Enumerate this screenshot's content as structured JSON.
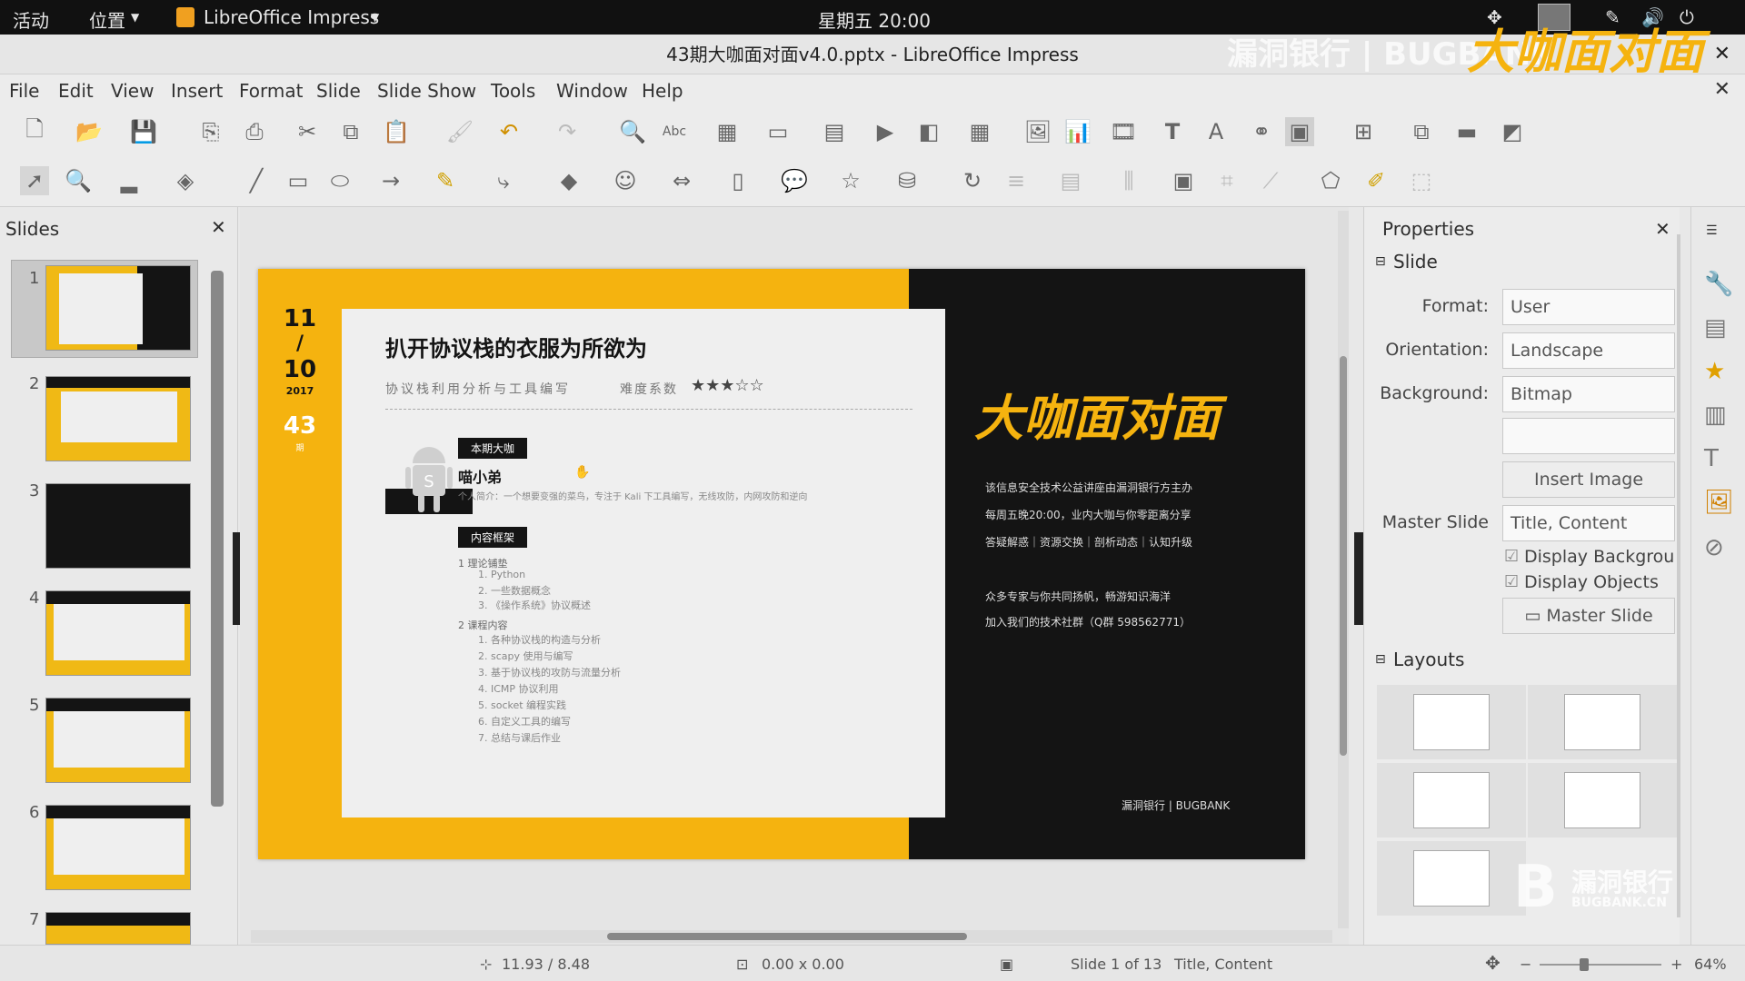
{
  "topbar": {
    "activities": "活动",
    "places": "位置",
    "app": "LibreOffice Impress",
    "clock": "星期五 20:00"
  },
  "window": {
    "title": "43期大咖面对面v4.0.pptx - LibreOffice Impress"
  },
  "watermark": {
    "text": "漏洞银行 | BUGBANK",
    "logo_text": "大咖面对面",
    "corner_cn": "漏洞银行",
    "corner_en": "BUGBANK.CN"
  },
  "menu": [
    "File",
    "Edit",
    "View",
    "Insert",
    "Format",
    "Slide",
    "Slide Show",
    "Tools",
    "Window",
    "Help"
  ],
  "slides_panel": {
    "title": "Slides",
    "numbers": [
      "1",
      "2",
      "3",
      "4",
      "5",
      "6",
      "7"
    ]
  },
  "slide": {
    "date_month": "11",
    "date_sep": "/",
    "date_day": "10",
    "date_year": "2017",
    "issue": "43",
    "issue_unit": "期",
    "title": "扒开协议栈的衣服为所欲为",
    "subtitle": "协议栈利用分析与工具编写",
    "difficulty_label": "难度系数",
    "stars": "★★★☆☆",
    "guest_tag": "本期大咖",
    "guest_name": "喵小弟",
    "guest_intro": "个人简介：一个想要变强的菜鸟，专注于 Kali 下工具编写，无线攻防，内网攻防和逆向",
    "outline_tag": "内容框架",
    "outline_1": "1  理论铺垫",
    "outline_1_items": [
      "1. Python",
      "2. 一些数据概念",
      "3. 《操作系统》协议概述"
    ],
    "outline_2": "2  课程内容",
    "outline_2_items": [
      "1. 各种协议栈的构造与分析",
      "2. scapy 使用与编写",
      "3. 基于协议栈的攻防与流量分析",
      "4. ICMP 协议利用",
      "5. socket 编程实践",
      "6. 自定义工具的编写",
      "7. 总结与课后作业"
    ],
    "brand": "大咖面对面",
    "desc_1": "该信息安全技术公益讲座由漏洞银行方主办",
    "desc_2": "每周五晚20:00，业内大咖与你零距离分享",
    "desc_3": "答疑解惑｜资源交换｜剖析动态｜认知升级",
    "desc_4": "众多专家与你共同扬帆，畅游知识海洋",
    "desc_5": "加入我们的技术社群（Q群 598562771）",
    "footer": "漏洞银行 | BUGBANK"
  },
  "properties": {
    "title": "Properties",
    "section_slide": "Slide",
    "format_label": "Format:",
    "format_value": "User",
    "orientation_label": "Orientation:",
    "orientation_value": "Landscape",
    "background_label": "Background:",
    "background_value": "Bitmap",
    "insert_image": "Insert Image",
    "master_label": "Master Slide",
    "master_value": "Title, Content",
    "display_bg": "Display Backgrou",
    "display_objects": "Display Objects",
    "master_button": "Master Slide",
    "section_layouts": "Layouts"
  },
  "status": {
    "position": "11.93 / 8.48",
    "size": "0.00 x 0.00",
    "slide": "Slide 1 of 13",
    "layout": "Title, Content",
    "zoom": "64%"
  },
  "colors": {
    "accent": "#f5b30f",
    "dark": "#141414",
    "card": "#efefef"
  }
}
